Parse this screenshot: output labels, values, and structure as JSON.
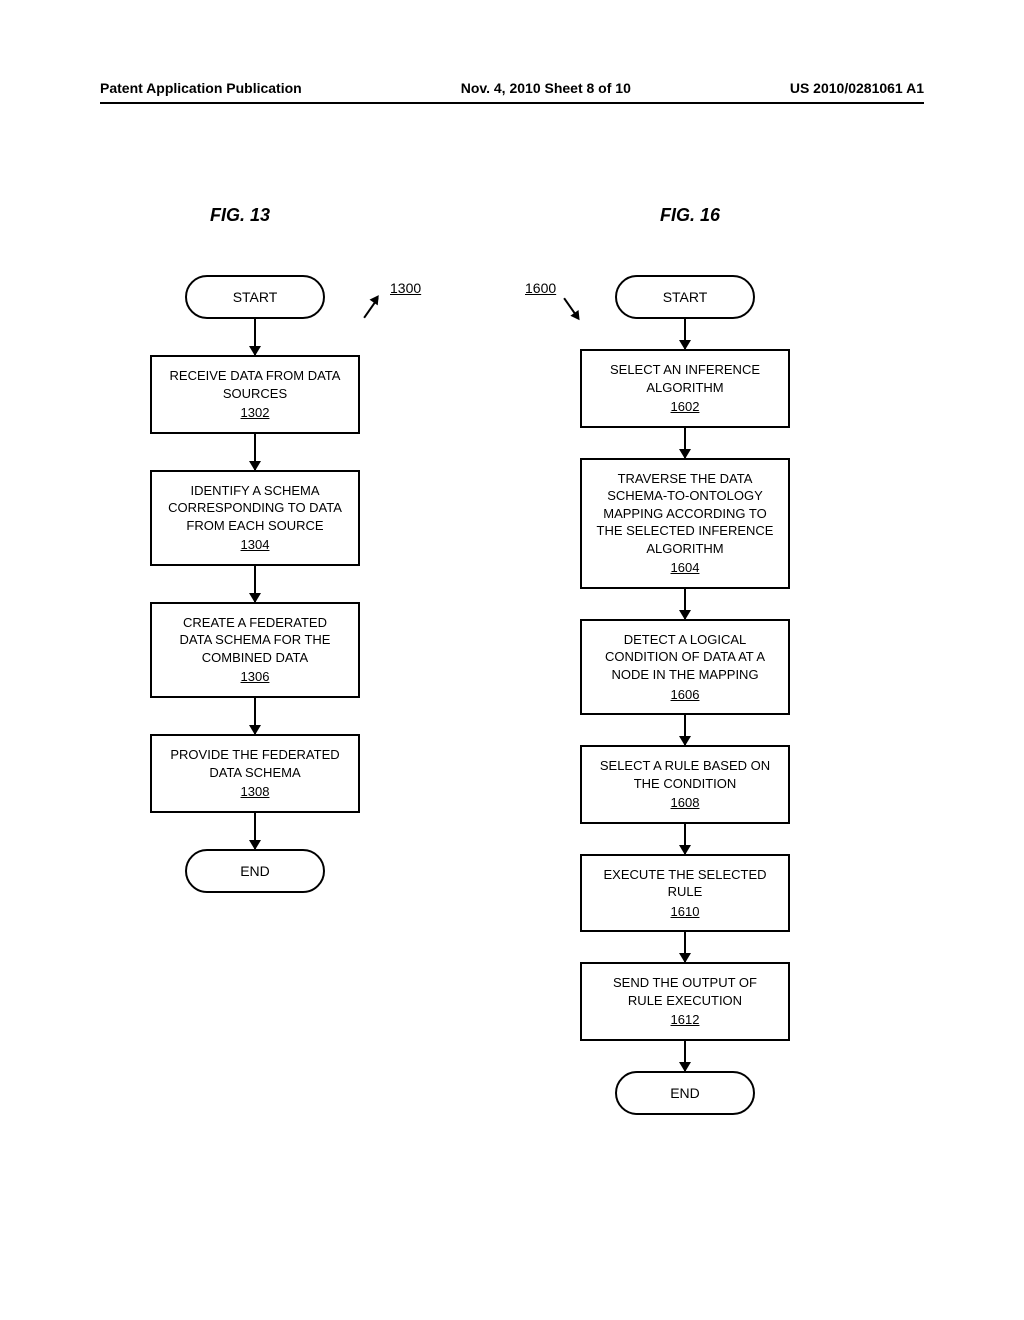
{
  "header": {
    "left": "Patent Application Publication",
    "center": "Nov. 4, 2010  Sheet 8 of 10",
    "right": "US 2010/0281061 A1"
  },
  "fig13": {
    "label": "FIG. 13",
    "ref": "1300",
    "start": "START",
    "end": "END",
    "steps": [
      {
        "text": "RECEIVE DATA FROM DATA SOURCES",
        "ref": "1302"
      },
      {
        "text": "IDENTIFY A SCHEMA CORRESPONDING TO DATA FROM EACH SOURCE",
        "ref": "1304"
      },
      {
        "text": "CREATE A FEDERATED DATA SCHEMA FOR THE COMBINED DATA",
        "ref": "1306"
      },
      {
        "text": "PROVIDE THE FEDERATED DATA SCHEMA",
        "ref": "1308"
      }
    ]
  },
  "fig16": {
    "label": "FIG. 16",
    "ref": "1600",
    "start": "START",
    "end": "END",
    "steps": [
      {
        "text": "SELECT AN INFERENCE ALGORITHM",
        "ref": "1602"
      },
      {
        "text": "TRAVERSE THE DATA SCHEMA-TO-ONTOLOGY MAPPING ACCORDING TO THE SELECTED INFERENCE ALGORITHM",
        "ref": "1604"
      },
      {
        "text": "DETECT A LOGICAL CONDITION OF DATA AT A NODE IN THE MAPPING",
        "ref": "1606"
      },
      {
        "text": "SELECT A RULE BASED ON THE CONDITION",
        "ref": "1608"
      },
      {
        "text": "EXECUTE THE SELECTED RULE",
        "ref": "1610"
      },
      {
        "text": "SEND THE OUTPUT OF RULE EXECUTION",
        "ref": "1612"
      }
    ]
  }
}
